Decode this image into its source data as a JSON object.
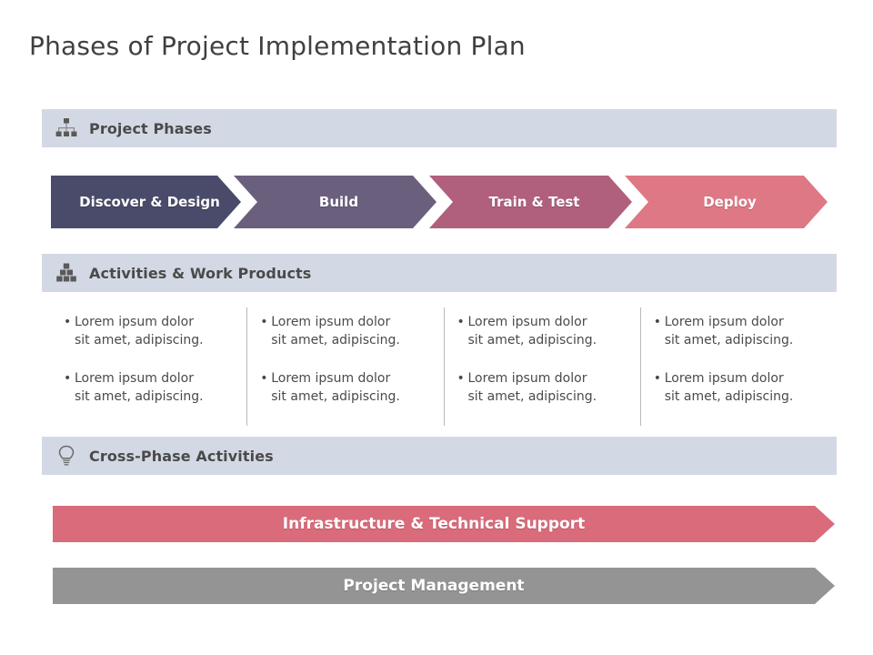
{
  "slide": {
    "title": "Phases of Project Implementation Plan"
  },
  "colors": {
    "section_bar_bg": "#d3d9e4",
    "section_label": "#4a4a4a",
    "title": "#404040",
    "phase_1": "#4a4b6b",
    "phase_2": "#6b5f7e",
    "phase_3": "#b05f7c",
    "phase_4": "#dd7884",
    "banner_infrastructure": "#d96b7a",
    "banner_project_management": "#949494",
    "divider": "#b9b9b9"
  },
  "sections": {
    "phases": {
      "icon": "org-chart-icon",
      "label": "Project Phases"
    },
    "activities": {
      "icon": "stacked-blocks-icon",
      "label": "Activities & Work Products"
    },
    "cross_phase": {
      "icon": "lightbulb-icon",
      "label": "Cross-Phase Activities"
    }
  },
  "phases": [
    {
      "label": "Discover  & Design",
      "color": "#4a4b6b"
    },
    {
      "label": "Build",
      "color": "#6b5f7e"
    },
    {
      "label": "Train & Test",
      "color": "#b05f7c"
    },
    {
      "label": "Deploy",
      "color": "#dd7884"
    }
  ],
  "columns": [
    {
      "bullets": [
        "Lorem ipsum dolor sit amet, adipiscing.",
        "Lorem ipsum dolor sit amet, adipiscing."
      ]
    },
    {
      "bullets": [
        "Lorem ipsum dolor sit amet, adipiscing.",
        "Lorem ipsum dolor sit amet, adipiscing."
      ]
    },
    {
      "bullets": [
        "Lorem ipsum dolor sit amet, adipiscing.",
        "Lorem ipsum dolor sit amet, adipiscing."
      ]
    },
    {
      "bullets": [
        "Lorem ipsum dolor sit amet, adipiscing.",
        "Lorem ipsum dolor sit amet, adipiscing."
      ]
    }
  ],
  "banners": [
    {
      "label": "Infrastructure & Technical Support",
      "color": "#d96b7a"
    },
    {
      "label": "Project Management",
      "color": "#949494"
    }
  ],
  "bullet_glyph": "•"
}
